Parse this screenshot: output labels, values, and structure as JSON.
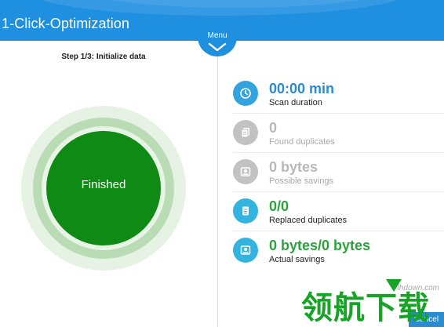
{
  "app": {
    "title": "1-Click-Optimization"
  },
  "menu": {
    "label": "Menu"
  },
  "progress": {
    "step_label": "Step 1/3: Initialize data",
    "status": "Finished"
  },
  "stats": [
    {
      "value": "00:00 min",
      "label": "Scan duration",
      "icon": "clock-icon",
      "state": "active"
    },
    {
      "value": "0",
      "label": "Found duplicates",
      "icon": "duplicate-files-icon",
      "state": "inactive"
    },
    {
      "value": "0 bytes",
      "label": "Possible savings",
      "icon": "disk-icon",
      "state": "inactive"
    },
    {
      "value": "0/0",
      "label": "Replaced duplicates",
      "icon": "document-icon",
      "state": "success"
    },
    {
      "value": "0 bytes/0 bytes",
      "label": "Actual savings",
      "icon": "disk-icon",
      "state": "success"
    }
  ],
  "footer": {
    "cancel_label": "Cancel"
  },
  "watermark": {
    "text": "领航下载",
    "domain": "lhdown.com"
  },
  "colors": {
    "header": "#1f8fe0",
    "finished": "#0f8a14",
    "accent_blue": "#2a8bd0",
    "accent_green": "#2aa33a",
    "inactive": "#b8b8b8"
  }
}
